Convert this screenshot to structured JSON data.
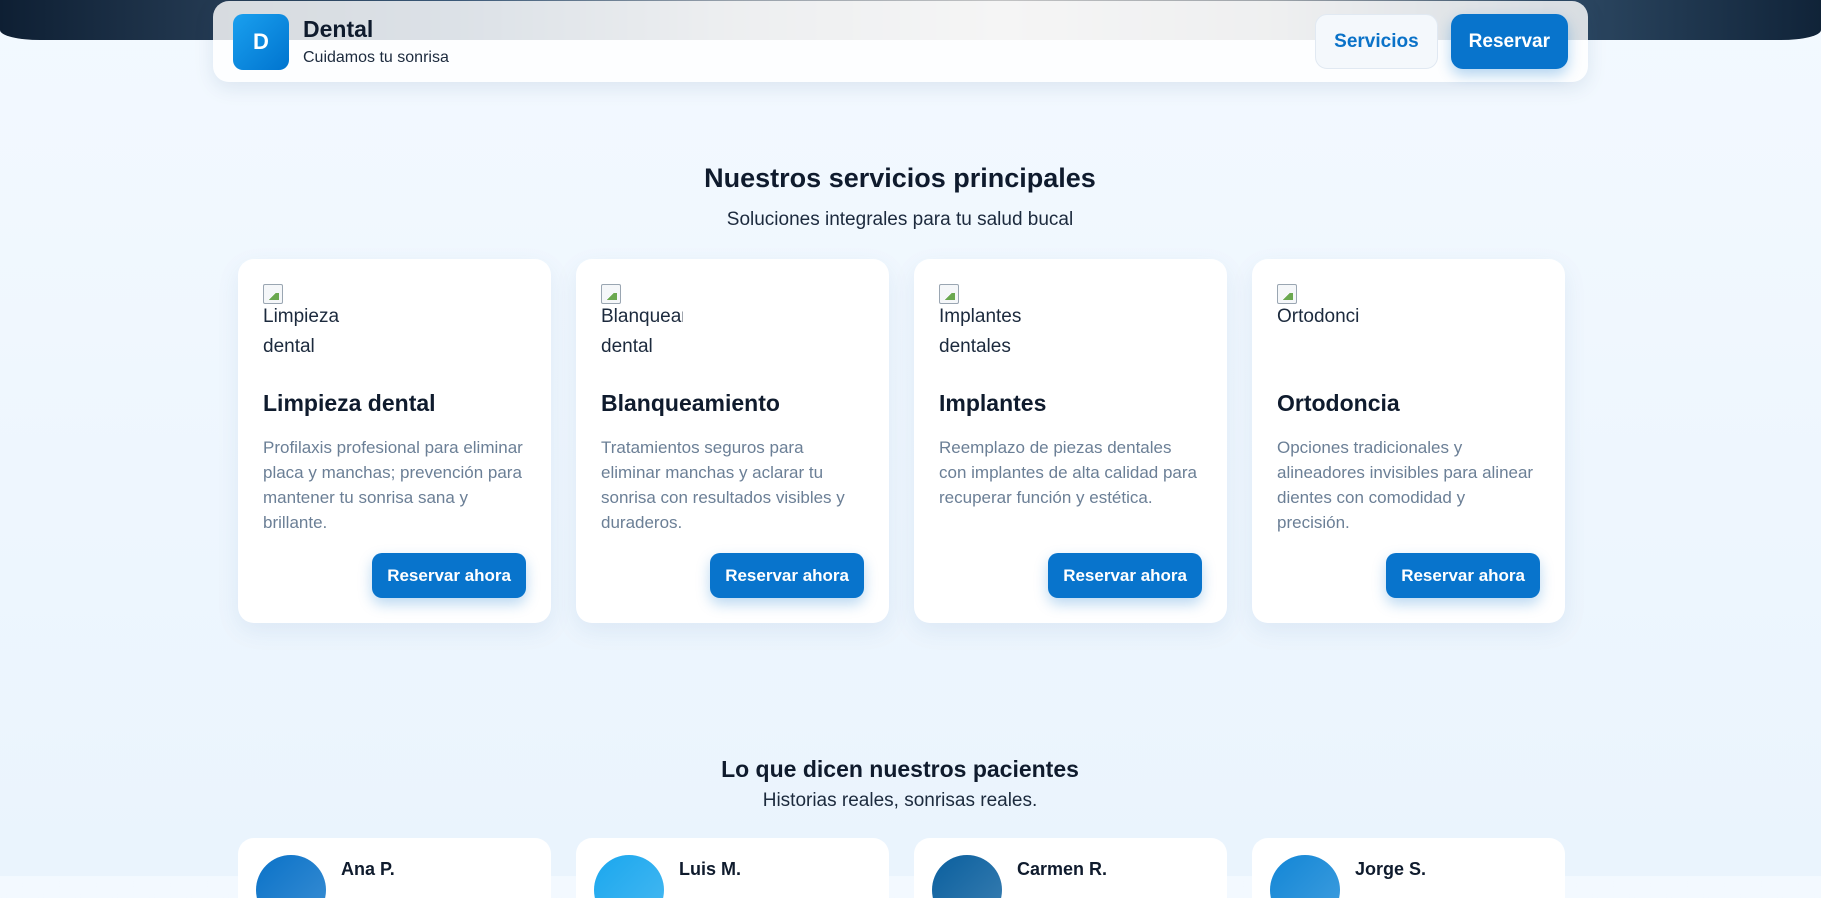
{
  "header": {
    "logo_letter": "D",
    "brand_name": "Dental",
    "tagline": "Cuidamos tu sonrisa",
    "nav_services": "Servicios",
    "nav_book": "Reservar"
  },
  "services": {
    "title": "Nuestros servicios principales",
    "subtitle": "Soluciones integrales para tu salud bucal",
    "items": [
      {
        "image_alt": "Limpieza dental",
        "title": "Limpieza dental",
        "description": "Profilaxis profesional para eliminar placa y manchas; prevención para mantener tu sonrisa sana y brillante.",
        "button": "Reservar ahora"
      },
      {
        "image_alt": "Blanqueamiento dental",
        "title": "Blanqueamiento",
        "description": "Tratamientos seguros para eliminar manchas y aclarar tu sonrisa con resultados visibles y duraderos.",
        "button": "Reservar ahora"
      },
      {
        "image_alt": "Implantes dentales",
        "title": "Implantes",
        "description": "Reemplazo de piezas dentales con implantes de alta calidad para recuperar función y estética.",
        "button": "Reservar ahora"
      },
      {
        "image_alt": "Ortodoncia",
        "title": "Ortodoncia",
        "description": "Opciones tradicionales y alineadores invisibles para alinear dientes con comodidad y precisión.",
        "button": "Reservar ahora"
      }
    ]
  },
  "testimonials": {
    "title": "Lo que dicen nuestros pacientes",
    "subtitle": "Historias reales, sonrisas reales.",
    "items": [
      {
        "name": "Ana P.",
        "avatar_color": "#0a72c8"
      },
      {
        "name": "Luis M.",
        "avatar_color": "#1aa7ee"
      },
      {
        "name": "Carmen R.",
        "avatar_color": "#0a5f9e"
      },
      {
        "name": "Jorge S.",
        "avatar_color": "#1286d6"
      }
    ]
  },
  "colors": {
    "primary": "#0874cc",
    "heading": "#0f1b2d",
    "muted_text": "#6b7f96",
    "background": "#f3f9ff"
  }
}
